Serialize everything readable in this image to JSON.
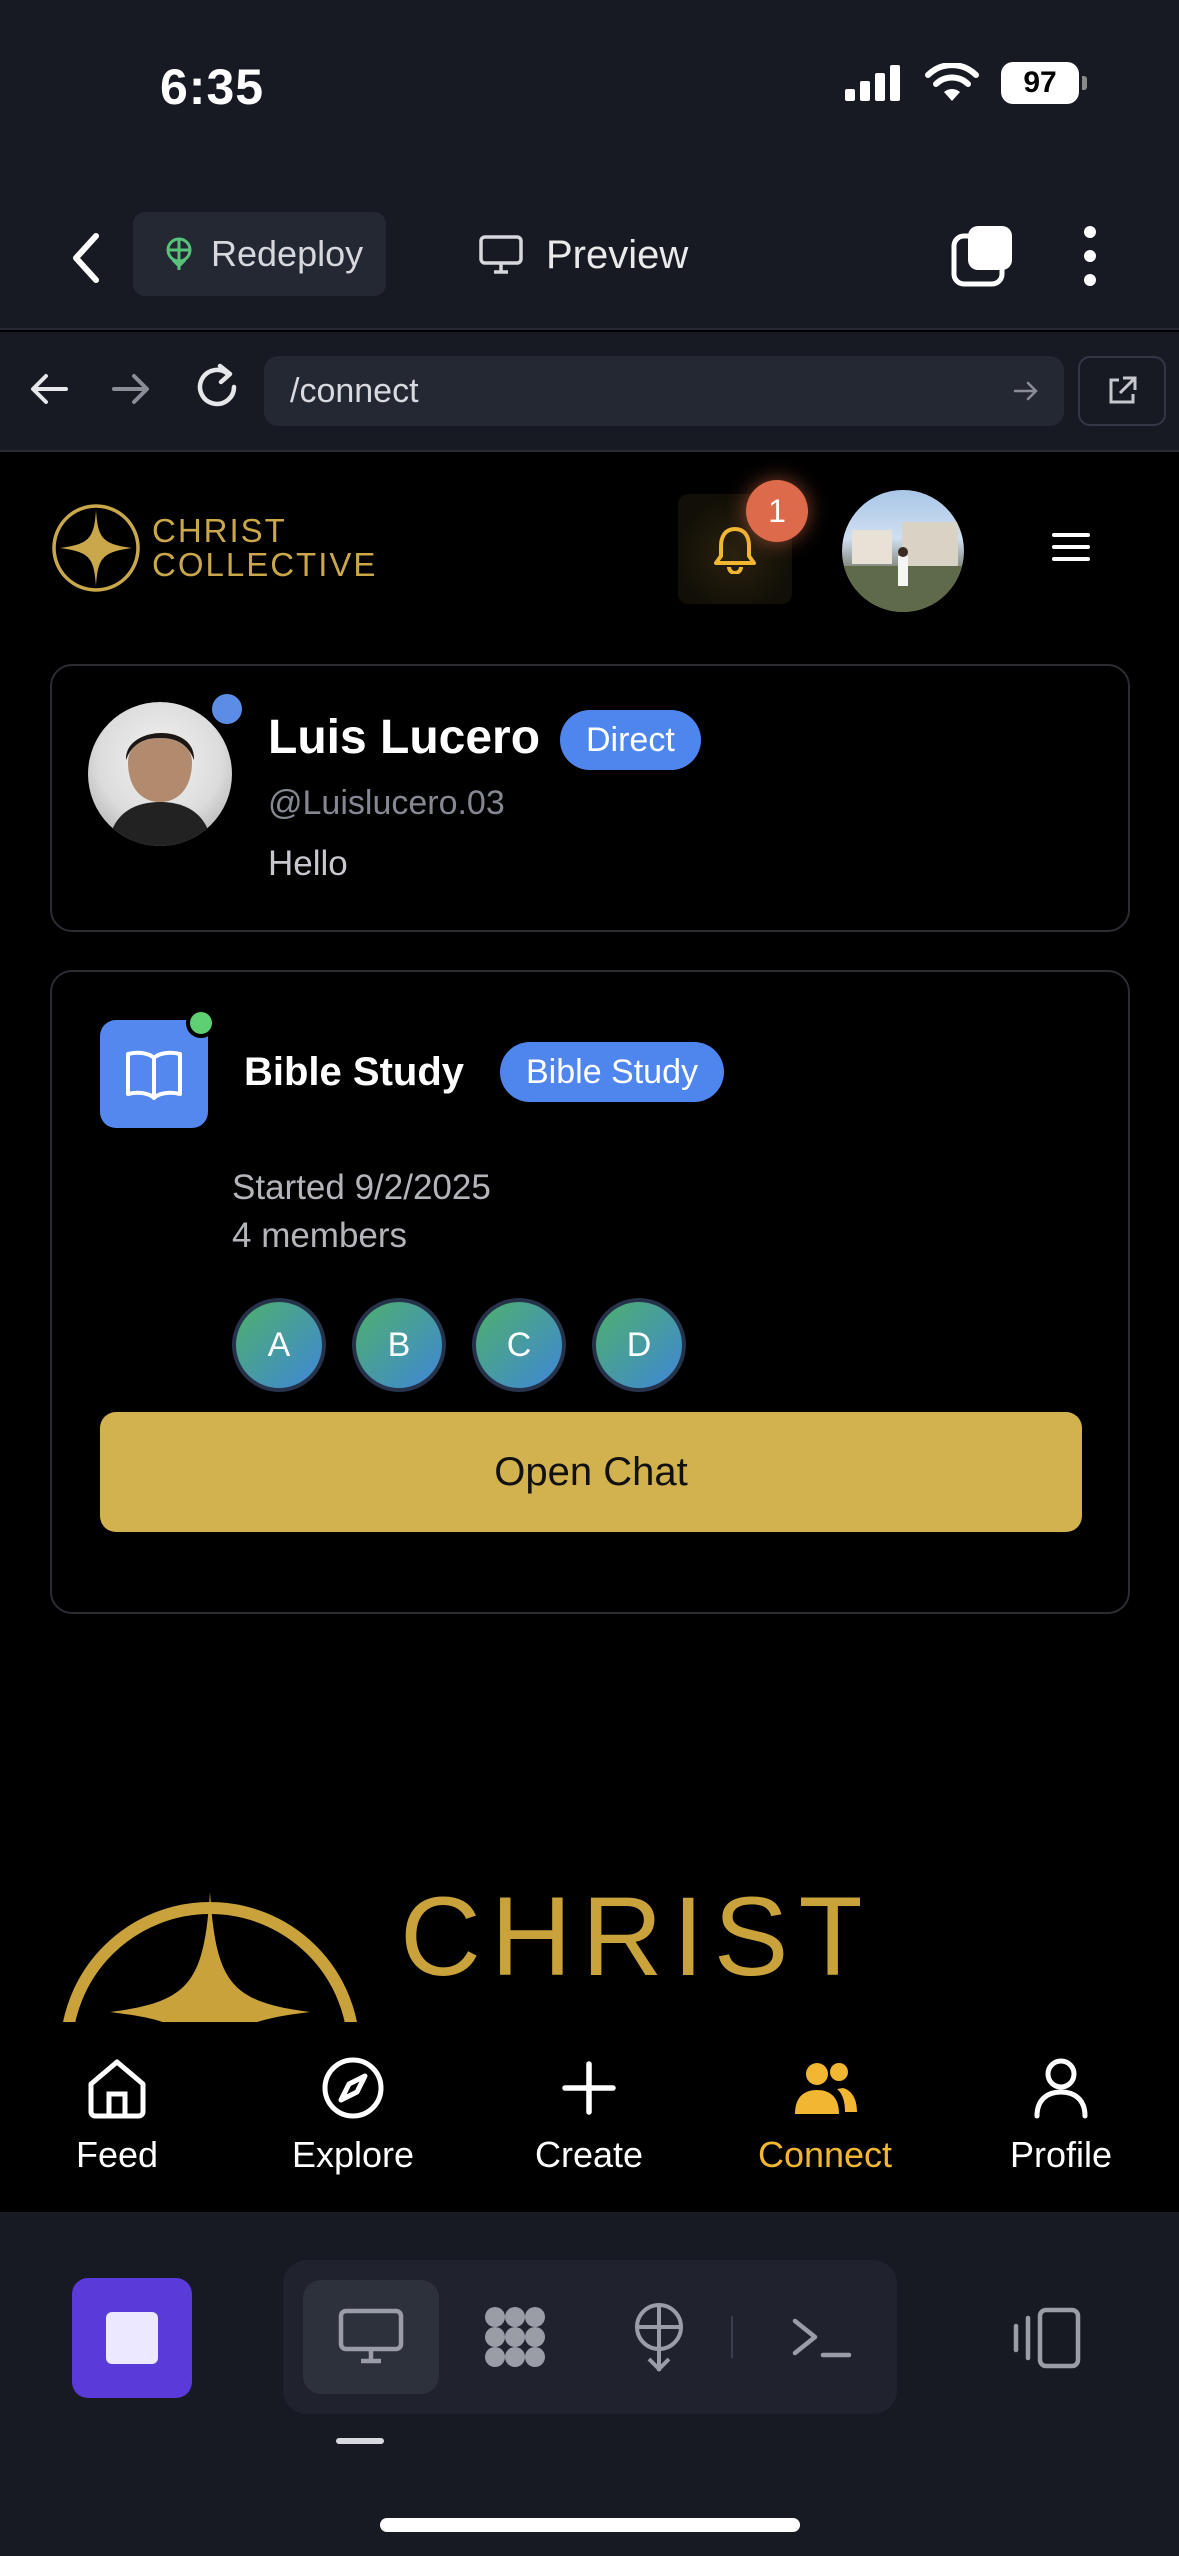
{
  "status_bar": {
    "time": "6:35",
    "battery": "97"
  },
  "app_toolbar": {
    "redeploy_label": "Redeploy",
    "preview_label": "Preview"
  },
  "browser": {
    "url": "/connect"
  },
  "site": {
    "logo_line1": "CHRIST",
    "logo_line2": "COLLECTIVE",
    "notification_count": "1"
  },
  "conversations": {
    "direct": {
      "name": "Luis Lucero",
      "badge": "Direct",
      "handle": "@Luislucero.03",
      "last_message": "Hello"
    },
    "group": {
      "name": "Bible Study",
      "badge": "Bible Study",
      "started": "Started 9/2/2025",
      "members_count": "4 members",
      "member_initials": [
        "A",
        "B",
        "C",
        "D"
      ],
      "open_chat_label": "Open Chat"
    }
  },
  "footer": {
    "logo_text": "CHRIST"
  },
  "tabbar": {
    "items": [
      {
        "label": "Feed",
        "icon": "home-icon"
      },
      {
        "label": "Explore",
        "icon": "compass-icon"
      },
      {
        "label": "Create",
        "icon": "plus-icon"
      },
      {
        "label": "Connect",
        "icon": "users-icon",
        "active": true
      },
      {
        "label": "Profile",
        "icon": "user-icon"
      }
    ],
    "active_color": "#f2b732"
  },
  "colors": {
    "gold": "#c9a74a",
    "button_gold": "#d2b14f",
    "badge_blue": "#4f86ee",
    "online_green": "#5fcf74"
  }
}
